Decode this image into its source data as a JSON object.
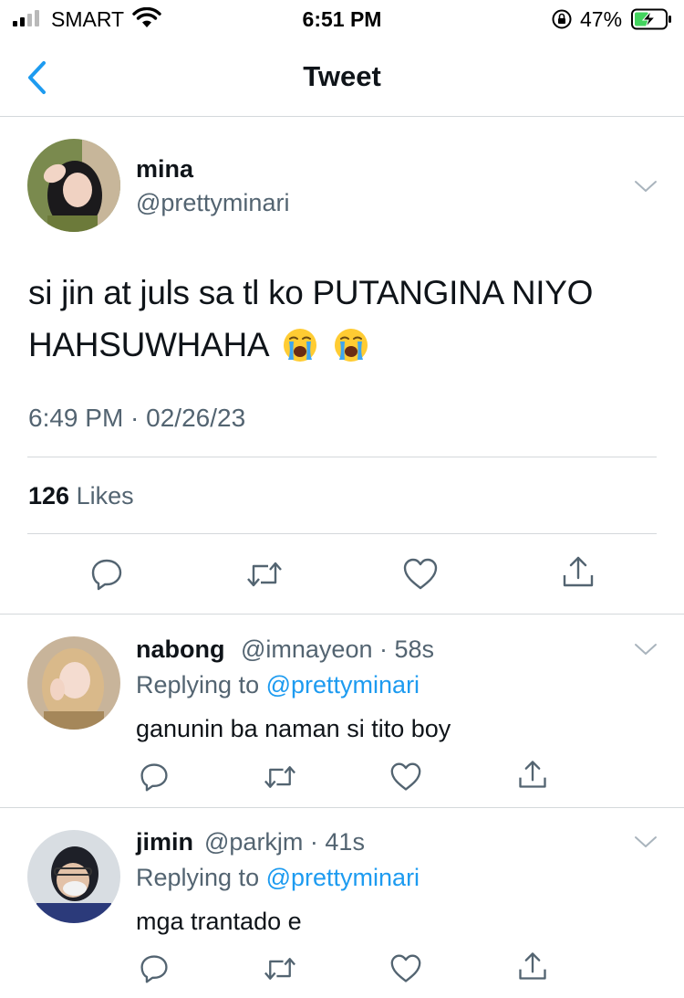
{
  "status_bar": {
    "carrier": "SMART",
    "time": "6:51 PM",
    "battery_percent": "47%"
  },
  "header": {
    "title": "Tweet"
  },
  "main_tweet": {
    "name": "mina",
    "handle": "@prettyminari",
    "text_line1": "si jin at juls sa tl ko PUTANGINA NIYO",
    "text_line2": "HAHSUWHAHA",
    "emojis": [
      "loudly-crying-face",
      "loudly-crying-face"
    ],
    "timestamp": "6:49 PM · 02/26/23",
    "likes_count": "126",
    "likes_label": "Likes"
  },
  "replies": [
    {
      "name": "nabong",
      "handle_time": "@imnayeon · 58s",
      "replying_label": "Replying to",
      "replying_to": "@prettyminari",
      "text": "ganunin ba naman si tito boy"
    },
    {
      "name": "jimin",
      "handle_time": "@parkjm · 41s",
      "replying_label": "Replying to",
      "replying_to": "@prettyminari",
      "text": "mga trantado e"
    }
  ],
  "icons": [
    "back-chevron-icon",
    "chevron-down-icon",
    "reply-icon",
    "retweet-icon",
    "like-icon",
    "share-icon"
  ],
  "colors": {
    "accent": "#1d9bf0",
    "secondary_text": "#536471",
    "divider": "#d4d8db"
  }
}
